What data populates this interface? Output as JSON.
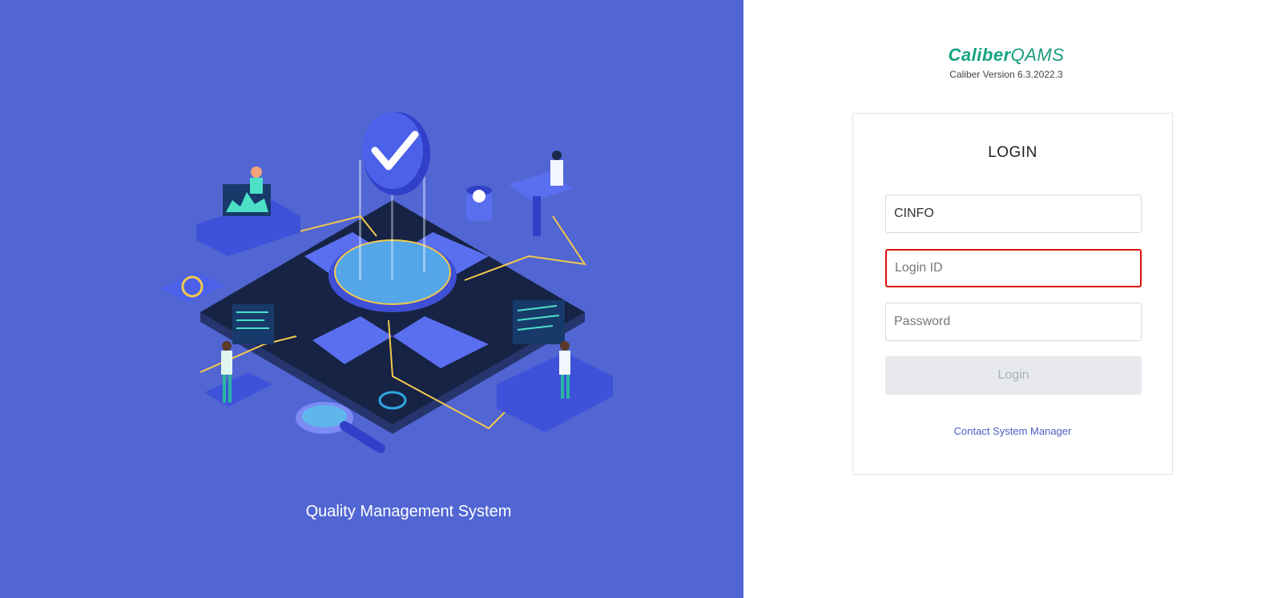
{
  "illustration": {
    "caption": "Quality Management System"
  },
  "brand": {
    "name_part1": "Caliber",
    "name_part2": "QAMS",
    "version": "Caliber Version 6.3.2022.3"
  },
  "login": {
    "title": "LOGIN",
    "company_value": "CINFO",
    "login_id_placeholder": "Login ID",
    "login_id_value": "",
    "password_placeholder": "Password",
    "password_value": "",
    "submit_label": "Login",
    "contact_link": "Contact System Manager"
  },
  "colors": {
    "left_panel_bg": "#5166d3",
    "brand_green": "#14a37f",
    "focus_border": "#e00b0b",
    "link": "#4a5ec5",
    "button_disabled_bg": "#e7e9ec"
  }
}
